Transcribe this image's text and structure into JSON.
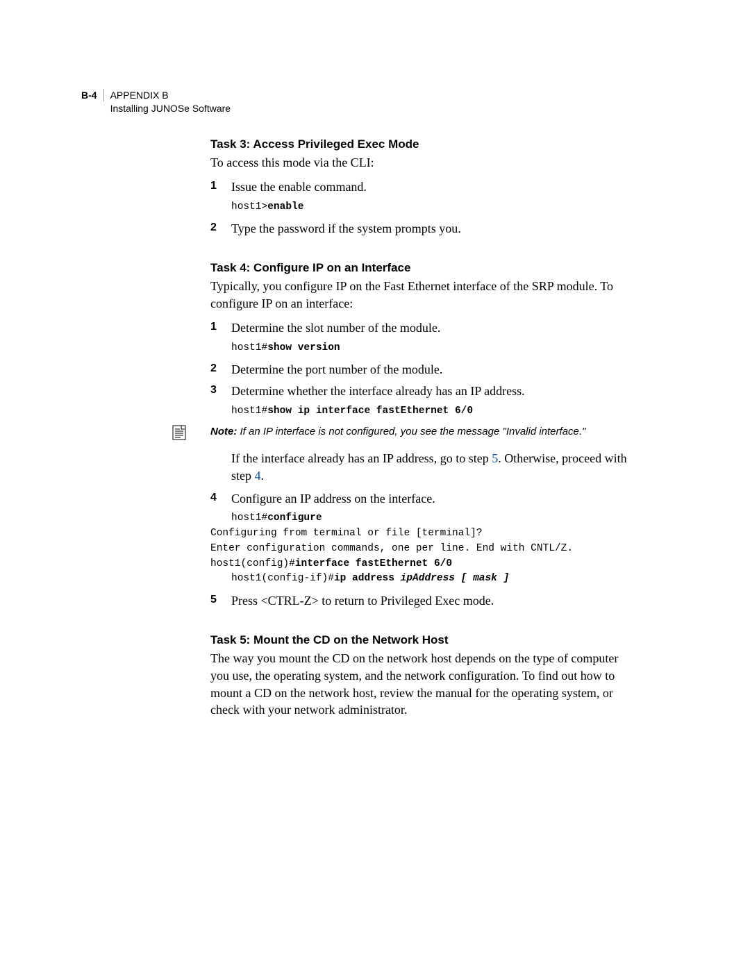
{
  "header": {
    "pagenum": "B-4",
    "appendix": "APPENDIX B",
    "subtitle": "Installing JUNOSe Software"
  },
  "task3": {
    "title": "Task 3: Access Privileged Exec Mode",
    "intro": "To access this mode via the CLI:",
    "step1": {
      "num": "1",
      "text": "Issue the enable command."
    },
    "code1_prompt": "host1>",
    "code1_cmd": "enable",
    "step2": {
      "num": "2",
      "text": "Type the password if the system prompts you."
    }
  },
  "task4": {
    "title": "Task 4: Configure IP on an Interface",
    "intro": "Typically, you configure IP on the Fast Ethernet interface of the SRP module. To configure IP on an interface:",
    "step1": {
      "num": "1",
      "text": "Determine the slot number of the module."
    },
    "code1_prompt": "host1#",
    "code1_cmd": "show version",
    "step2": {
      "num": "2",
      "text": "Determine the port number of the module."
    },
    "step3": {
      "num": "3",
      "text": "Determine whether the interface already has an IP address."
    },
    "code3_prompt": "host1#",
    "code3_cmd": "show ip interface fastEthernet 6/0",
    "note_label": "Note:",
    "note_text": " If an IP interface is not configured, you see the message \"Invalid interface.\"",
    "after_note_a": "If the interface already has an IP address, go to step ",
    "xref5": "5",
    "after_note_b": ". Otherwise, proceed with step ",
    "xref4": "4",
    "after_note_c": ".",
    "step4": {
      "num": "4",
      "text": "Configure an IP address on the interface."
    },
    "code4_l1_prompt": "host1#",
    "code4_l1_cmd": "configure",
    "code4_l2": "Configuring from terminal or file [terminal]?",
    "code4_l3": "Enter configuration commands, one per line. End with CNTL/Z.",
    "code4_l4_prompt": "host1(config)#",
    "code4_l4_cmd": "interface fastEthernet 6/0",
    "code4_l5_prompt": "host1(config-if)#",
    "code4_l5_cmd": "ip address ",
    "code4_l5_args": "ipAddress [ mask ]",
    "step5": {
      "num": "5",
      "text": "Press <CTRL-Z> to return to Privileged Exec mode."
    }
  },
  "task5": {
    "title": "Task 5: Mount the CD on the Network Host",
    "body": "The way you mount the CD on the network host depends on the type of computer you use, the operating system, and the network configuration. To find out how to mount a CD on the network host, review the manual for the operating system, or check with your network administrator."
  }
}
